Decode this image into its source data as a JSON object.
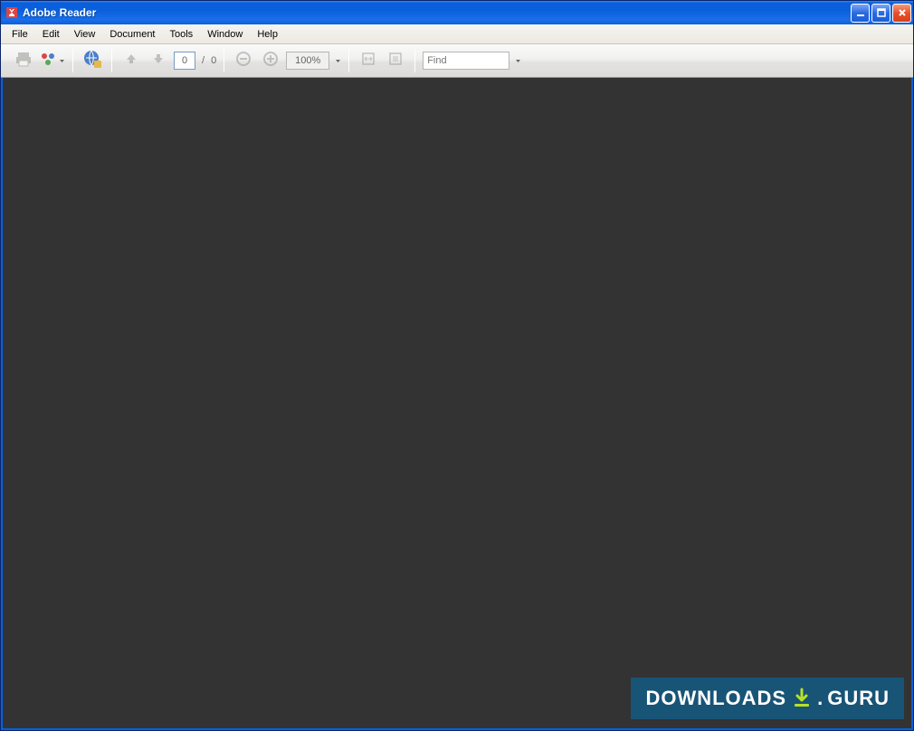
{
  "titlebar": {
    "title": "Adobe Reader"
  },
  "menubar": {
    "items": [
      "File",
      "Edit",
      "View",
      "Document",
      "Tools",
      "Window",
      "Help"
    ]
  },
  "toolbar": {
    "page_current": "0",
    "page_separator": "/",
    "page_total": "0",
    "zoom_value": "100%",
    "find_placeholder": "Find"
  },
  "watermark": {
    "text1": "DOWNLOADS",
    "dot": ".",
    "text2": "GURU"
  }
}
